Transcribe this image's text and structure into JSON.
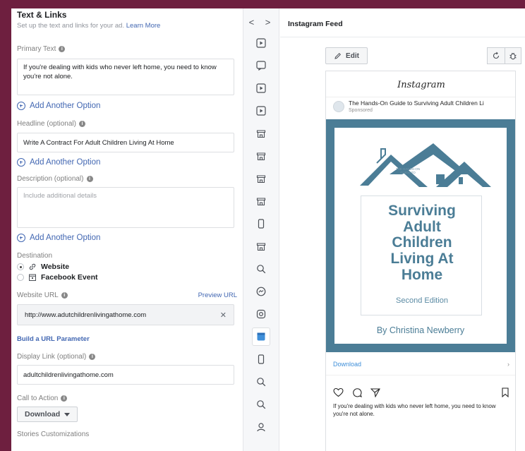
{
  "text_links": {
    "title": "Text & Links",
    "subtitle": "Set up the text and links for your ad.",
    "learn_more": "Learn More"
  },
  "primary_text": {
    "label": "Primary Text",
    "value": "If you're dealing with kids who never left home,  you need to know you're not alone."
  },
  "add_option_label": "Add Another Option",
  "headline": {
    "label": "Headline (optional)",
    "value": "Write A Contract For Adult Children Living At Home"
  },
  "description": {
    "label": "Description (optional)",
    "placeholder": "Include additional details"
  },
  "destination": {
    "label": "Destination",
    "options": [
      {
        "label": "Website",
        "selected": true
      },
      {
        "label": "Facebook Event",
        "selected": false
      }
    ]
  },
  "website_url": {
    "label": "Website URL",
    "preview_link": "Preview URL",
    "value": "http://www.adutchildrenlivingathome.com",
    "clear_symbol": "✕"
  },
  "build_url_param": "Build a URL Parameter",
  "display_link": {
    "label": "Display Link (optional)",
    "value": "adultchildrenlivingathome.com"
  },
  "call_to_action": {
    "label": "Call to Action",
    "value": "Download"
  },
  "stories_customizations": "Stories Customizations",
  "toolbar": {
    "nav": "< >",
    "items": [
      "story-play-icon",
      "story-card-icon",
      "play-icon",
      "play-icon",
      "storefront-icon",
      "storefront-icon",
      "storefront-icon",
      "storefront-icon",
      "phone-icon",
      "storefront-icon",
      "search-icon",
      "messenger-icon",
      "instagram-icon",
      "instagram-feed-icon",
      "phone-icon",
      "search-icon",
      "search-icon",
      "person-icon"
    ],
    "active_index": 13
  },
  "preview": {
    "title": "Instagram Feed",
    "edit_label": "Edit",
    "ig_logo": "Instagram",
    "page_name": "The Hands-On Guide to Surviving Adult Children Li",
    "sponsored": "Sponsored",
    "cover_small_text": "THE HANDS-ON GUIDE TO",
    "book_title": [
      "Surviving",
      "Adult",
      "Children",
      "Living At",
      "Home"
    ],
    "edition": "Second Edition",
    "author": "By Christina Newberry",
    "cta": "Download",
    "caption": "If you're dealing with kids who never left home, you need to know you're not alone."
  },
  "colors": {
    "background": "#6e1f3f",
    "brand_blue": "#4267b2",
    "creative_teal": "#4b7d96"
  }
}
